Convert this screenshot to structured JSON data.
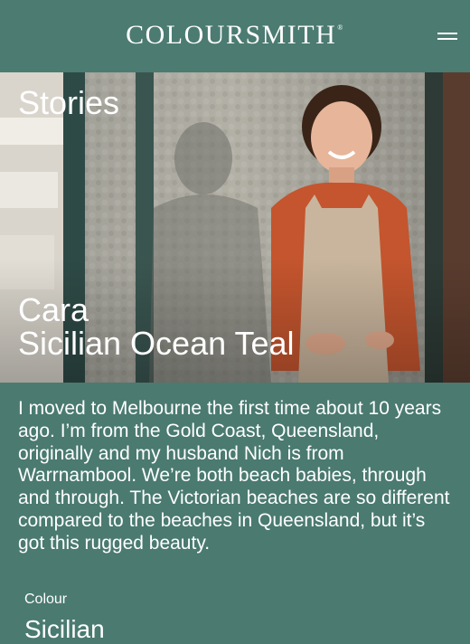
{
  "header": {
    "logo_text": "COLOURSMITH",
    "logo_mark": "®",
    "menu_icon": "hamburger-menu-icon"
  },
  "hero": {
    "section_title": "Stories",
    "person_name": "Cara",
    "colour_name": "Sicilian Ocean Teal"
  },
  "story": {
    "text": "I moved to Melbourne the first time about 10 years ago. I’m from the Gold Coast, Queensland, originally and my husband Nich is from Warrnambool. We’re both beach babies, through and through. The Victorian beaches are so different compared to the beaches in Queensland, but it’s got this rugged beauty."
  },
  "details": {
    "colour_label": "Colour",
    "colour_value": "Sicilian"
  },
  "colors": {
    "brand_teal": "#4b7b71",
    "text": "#ffffff"
  }
}
